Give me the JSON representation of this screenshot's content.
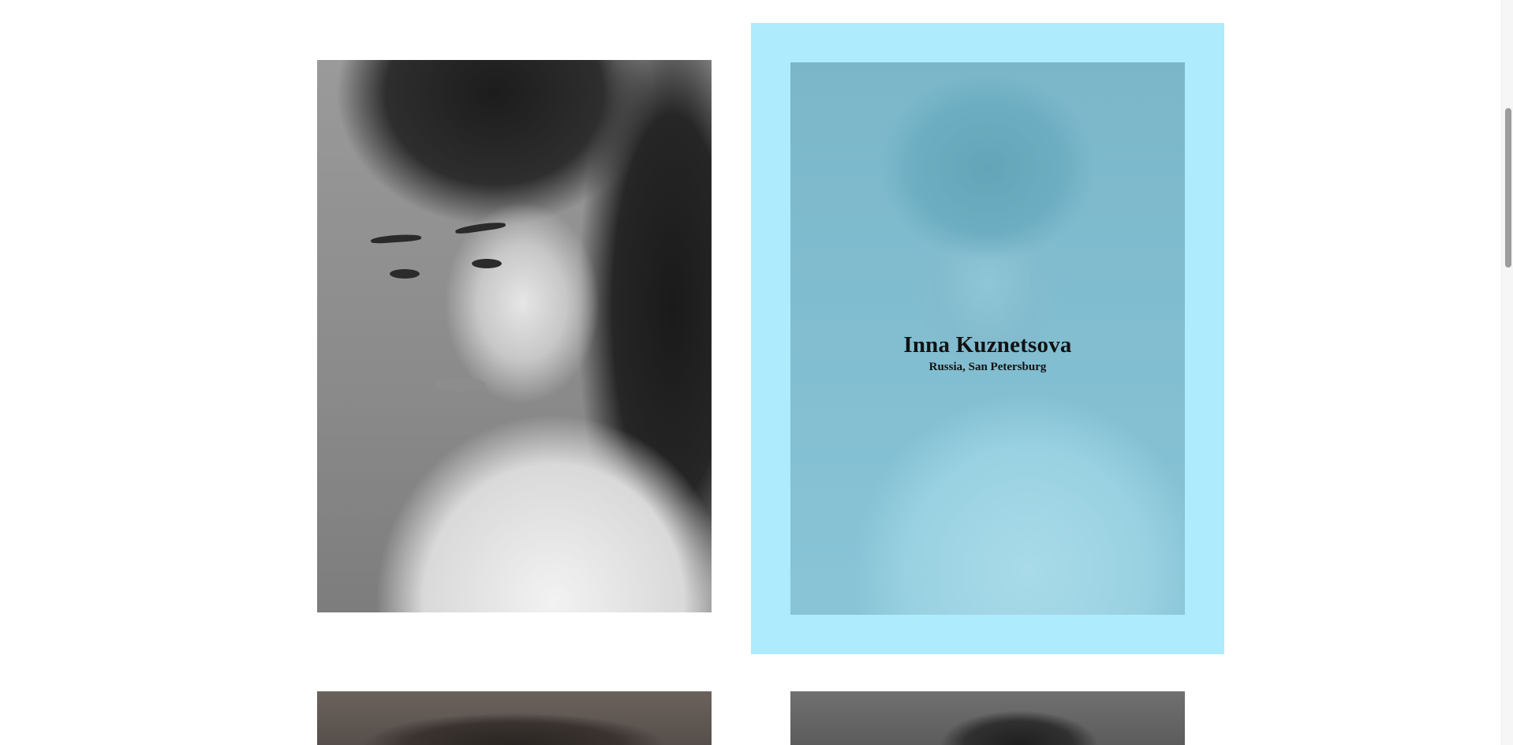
{
  "gallery": {
    "cards": [
      {
        "name": "",
        "location": "",
        "photo": "grayscale portrait"
      },
      {
        "name": "Inna Kuznetsova",
        "location": "Russia, San Petersburg",
        "photo": "tinted portrait",
        "state": "hover"
      },
      {
        "name": "",
        "location": "",
        "photo": "portrait"
      },
      {
        "name": "",
        "location": "",
        "photo": "portrait"
      }
    ],
    "hover_overlay_color": "#aeebfc"
  },
  "scrollbar": {
    "position_fraction": 0.15
  }
}
